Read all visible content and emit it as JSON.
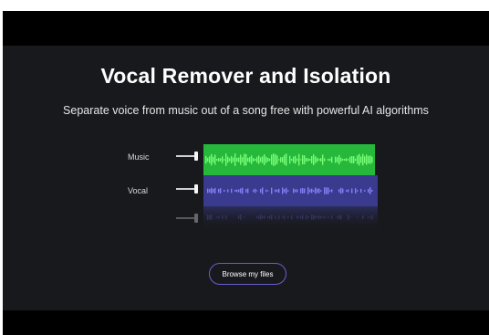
{
  "hero": {
    "title": "Vocal Remover and Isolation",
    "subtitle": "Separate voice from music out of a song free with powerful AI algorithms"
  },
  "editor": {
    "tracks": [
      {
        "label": "Music",
        "color": "#3fd14f"
      },
      {
        "label": "Vocal",
        "color": "#4a4aa8"
      }
    ]
  },
  "actions": {
    "browse_label": "Browse my files",
    "accent_color": "#6b5dd3"
  }
}
